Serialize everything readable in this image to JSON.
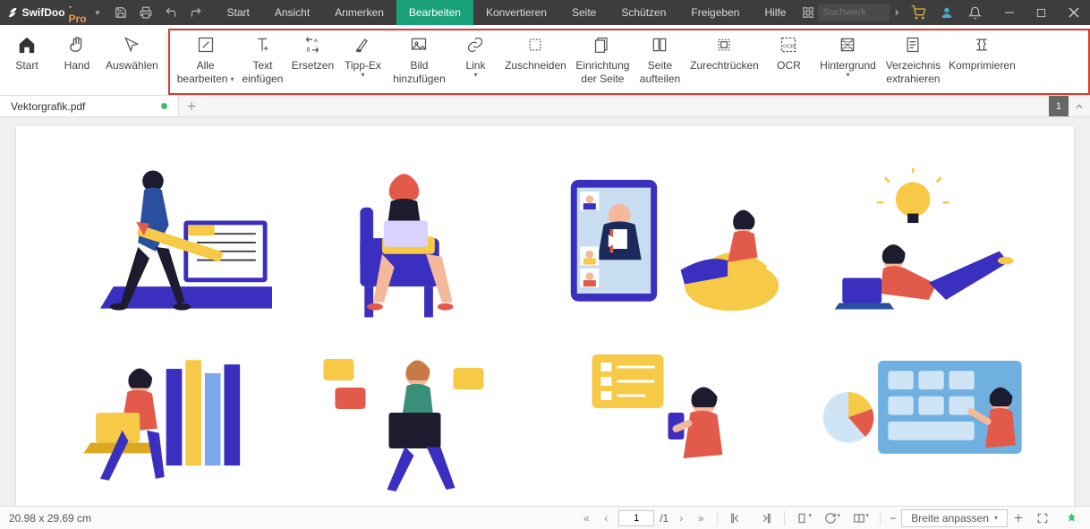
{
  "app": {
    "name_a": "SwifDoo",
    "name_b": "-Pro"
  },
  "menu": {
    "start": "Start",
    "view": "Ansicht",
    "annotate": "Anmerken",
    "edit": "Bearbeiten",
    "convert": "Konvertieren",
    "page": "Seite",
    "protect": "Schützen",
    "share": "Freigeben",
    "help": "Hilfe"
  },
  "search": {
    "placeholder": "Suchwerk"
  },
  "ribbon": {
    "home": "Start",
    "hand": "Hand",
    "select": "Auswählen",
    "edit_all_1": "Alle",
    "edit_all_2": "bearbeiten",
    "text_1": "Text",
    "text_2": "einfügen",
    "replace": "Ersetzen",
    "tippex": "Tipp-Ex",
    "image_1": "Bild",
    "image_2": "hinzufügen",
    "link": "Link",
    "crop": "Zuschneiden",
    "setup_1": "Einrichtung",
    "setup_2": "der Seite",
    "split_1": "Seite",
    "split_2": "aufteilen",
    "straighten": "Zurechtrücken",
    "ocr": "OCR",
    "bg": "Hintergrund",
    "toc_1": "Verzeichnis",
    "toc_2": "extrahieren",
    "compress": "Komprimieren"
  },
  "tab": {
    "filename": "Vektorgrafik.pdf"
  },
  "pagecount_badge": "1",
  "status": {
    "dims": "20.98 x 29.69 cm",
    "page_current": "1",
    "page_total": "/1",
    "fit": "Breite anpassen"
  }
}
